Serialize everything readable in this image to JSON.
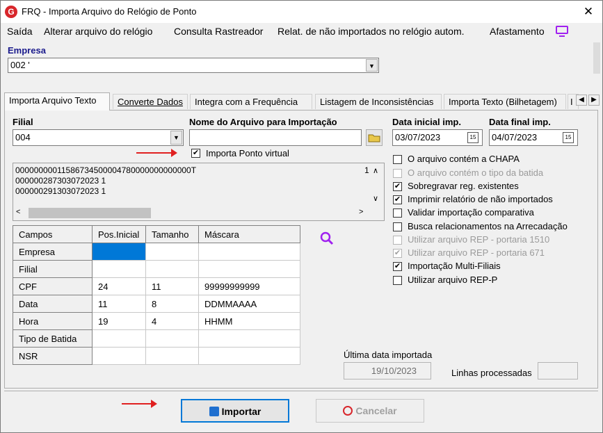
{
  "window": {
    "title": "FRQ - Importa Arquivo do Relógio de Ponto",
    "logo": "G",
    "close": "✕"
  },
  "menu": [
    "Saída",
    "Alterar arquivo do relógio",
    "Consulta Rastreador",
    "Relat. de não importados no relógio autom.",
    "Afastamento"
  ],
  "empresa": {
    "label": "Empresa",
    "value": "002 '"
  },
  "tabs": [
    "Importa Arquivo Texto",
    "Converte Dados",
    "Integra com a Frequência",
    "Listagem de Inconsistências",
    "Importa Texto (Bilhetagem)",
    "I"
  ],
  "filial": {
    "label": "Filial",
    "value": "004"
  },
  "arquivo": {
    "label": "Nome do Arquivo para Importação",
    "value": ""
  },
  "data_inicial": {
    "label": "Data inicial imp.",
    "value": "03/07/2023",
    "cal": "15"
  },
  "data_final": {
    "label": "Data final imp.",
    "value": "04/07/2023",
    "cal": "15"
  },
  "ponto_virtual": {
    "label": "Importa Ponto virtual",
    "checked": true
  },
  "text_preview": {
    "lines": [
      "00000000011586734500004780000000000000T",
      "000000287303072023 1",
      "000000291303072023 1"
    ],
    "line_numbers": [
      "1"
    ]
  },
  "grid": {
    "headers": [
      "Campos",
      "Pos.Inicial",
      "Tamanho",
      "Máscara"
    ],
    "rows": [
      [
        "Empresa",
        "",
        "",
        ""
      ],
      [
        "Filial",
        "",
        "",
        ""
      ],
      [
        "CPF",
        "24",
        "11",
        "99999999999"
      ],
      [
        "Data",
        "11",
        "8",
        "DDMMAAAA"
      ],
      [
        "Hora",
        "19",
        "4",
        "HHMM"
      ],
      [
        "Tipo de Batida",
        "",
        "",
        ""
      ],
      [
        "NSR",
        "",
        "",
        ""
      ]
    ]
  },
  "options": [
    {
      "label": "O arquivo contém a CHAPA",
      "checked": false,
      "enabled": true
    },
    {
      "label": "O arquivo contém o tipo da batida",
      "checked": false,
      "enabled": false
    },
    {
      "label": "Sobregravar reg. existentes",
      "checked": true,
      "enabled": true
    },
    {
      "label": "Imprimir relatório de não importados",
      "checked": true,
      "enabled": true
    },
    {
      "label": "Validar importação comparativa",
      "checked": false,
      "enabled": true
    },
    {
      "label": "Busca relacionamentos na Arrecadação",
      "checked": false,
      "enabled": true
    },
    {
      "label": "Utilizar arquivo REP - portaria 1510",
      "checked": false,
      "enabled": false
    },
    {
      "label": "Utilizar arquivo REP - portaria 671",
      "checked": true,
      "enabled": false
    },
    {
      "label": "Importação Multi-Filiais",
      "checked": true,
      "enabled": true
    },
    {
      "label": "Utilizar arquivo REP-P",
      "checked": false,
      "enabled": true
    }
  ],
  "ultima_data": {
    "label": "Última data importada",
    "value": "19/10/2023"
  },
  "linhas": {
    "label": "Linhas processadas",
    "value": ""
  },
  "buttons": {
    "importar": "Importar",
    "cancelar": "Cancelar"
  },
  "colors": {
    "accent": "#a020f0",
    "arrow": "#e02020",
    "selected_cell": "#0078d7"
  }
}
